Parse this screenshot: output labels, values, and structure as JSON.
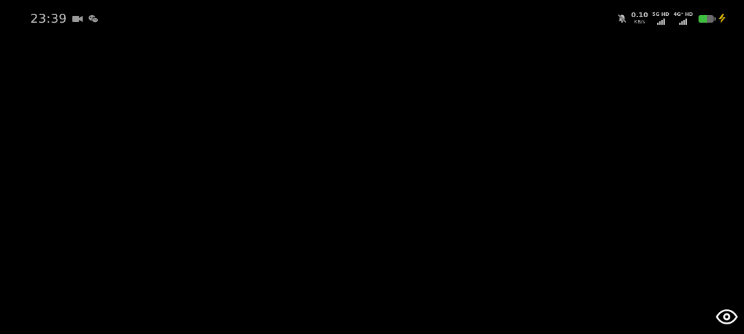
{
  "status_bar": {
    "time": "23:39",
    "left_icons": [
      "video-camera-icon",
      "wechat-icon"
    ],
    "net_speed": {
      "value": "0.10",
      "unit": "KB/s"
    },
    "signal_1": {
      "label": "5G HD",
      "level": 4
    },
    "signal_2": {
      "label": "4G⁺ HD",
      "level": 4
    },
    "battery": {
      "level": 0.55,
      "color": "#3fbf3f"
    },
    "charging_color": "#d9b400",
    "right_icons": [
      "mute-bell-icon",
      "charging-bolt-icon"
    ]
  },
  "controls": {
    "visibility_icon": "eye-icon"
  }
}
